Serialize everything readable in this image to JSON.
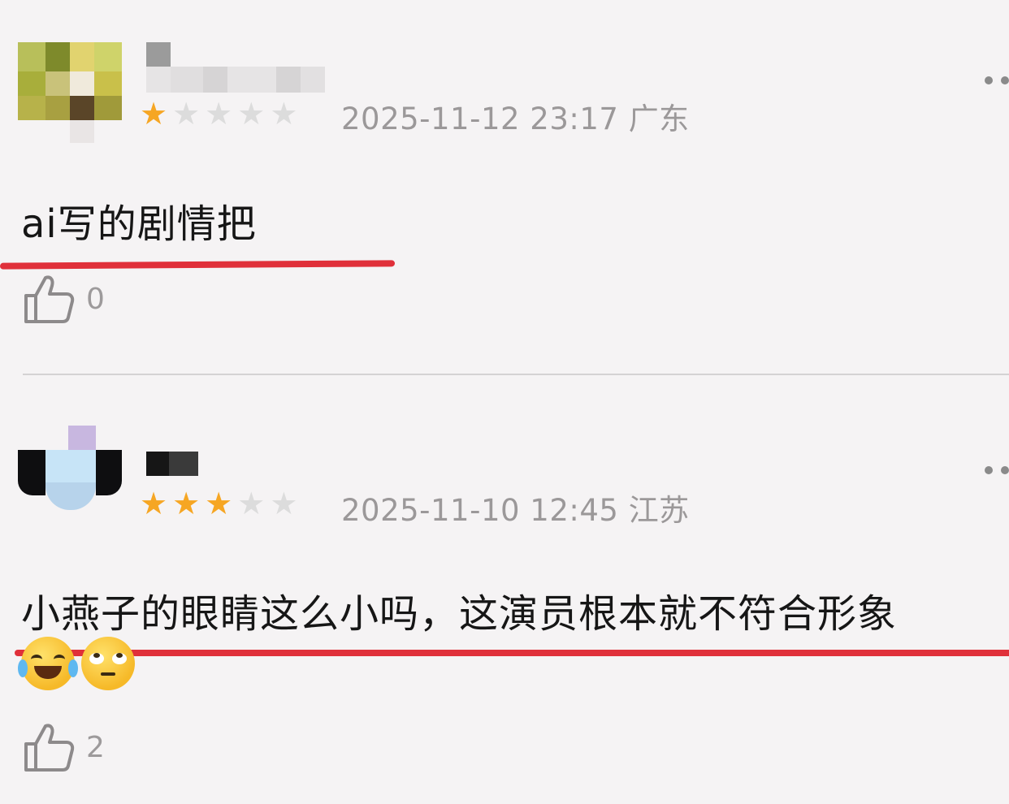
{
  "comments": [
    {
      "rating": 1,
      "max_rating": 5,
      "timestamp": "2025-11-12 23:17",
      "location": "广东",
      "text": "ai写的剧情把",
      "likes": "0"
    },
    {
      "rating": 3,
      "max_rating": 5,
      "timestamp": "2025-11-10 12:45",
      "location": "江苏",
      "text": "小燕子的眼睛这么小吗，这演员根本就不符合形象",
      "emojis": [
        "laughing-crying-emoji",
        "rolling-eyes-emoji"
      ],
      "likes": "2"
    }
  ],
  "colors": {
    "star_filled": "#f6a623",
    "star_empty": "#dcdcdc",
    "highlight_underline": "#e0303a",
    "meta_text": "#9b9899",
    "background": "#f5f3f4"
  },
  "icons": {
    "like": "thumbs-up-icon",
    "more": "more-options-icon"
  }
}
